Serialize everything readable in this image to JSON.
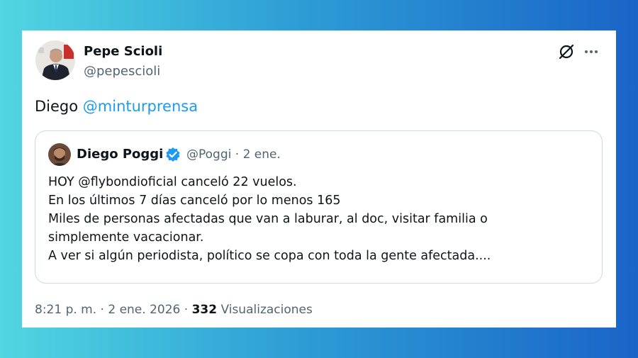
{
  "tweet": {
    "author_name": "Pepe Scioli",
    "author_handle": "@pepescioli",
    "text_prefix": "Diego ",
    "mention": "@minturprensa",
    "timestamp": "8:21 p. m. · 2 ene. 2026 · ",
    "views_count": "332",
    "views_label": " Visualizaciones"
  },
  "quote": {
    "author_name": "Diego Poggi",
    "meta": "@Poggi · 2 ene.",
    "lines": [
      "HOY @flybondioficial canceló 22 vuelos.",
      "En los últimos 7 días canceló por lo menos 165",
      "Miles de personas afectadas que van a laburar, al doc, visitar familia o",
      "simplemente vacacionar.",
      "A ver si algún periodista, político se copa con toda la gente afectada...."
    ]
  },
  "icons": {
    "grok": "grok-icon",
    "more": "more-icon",
    "verified": "verified-badge-icon"
  },
  "colors": {
    "mention": "#1d9bf0",
    "secondary_text": "#536471",
    "verified": "#1d9bf0"
  }
}
